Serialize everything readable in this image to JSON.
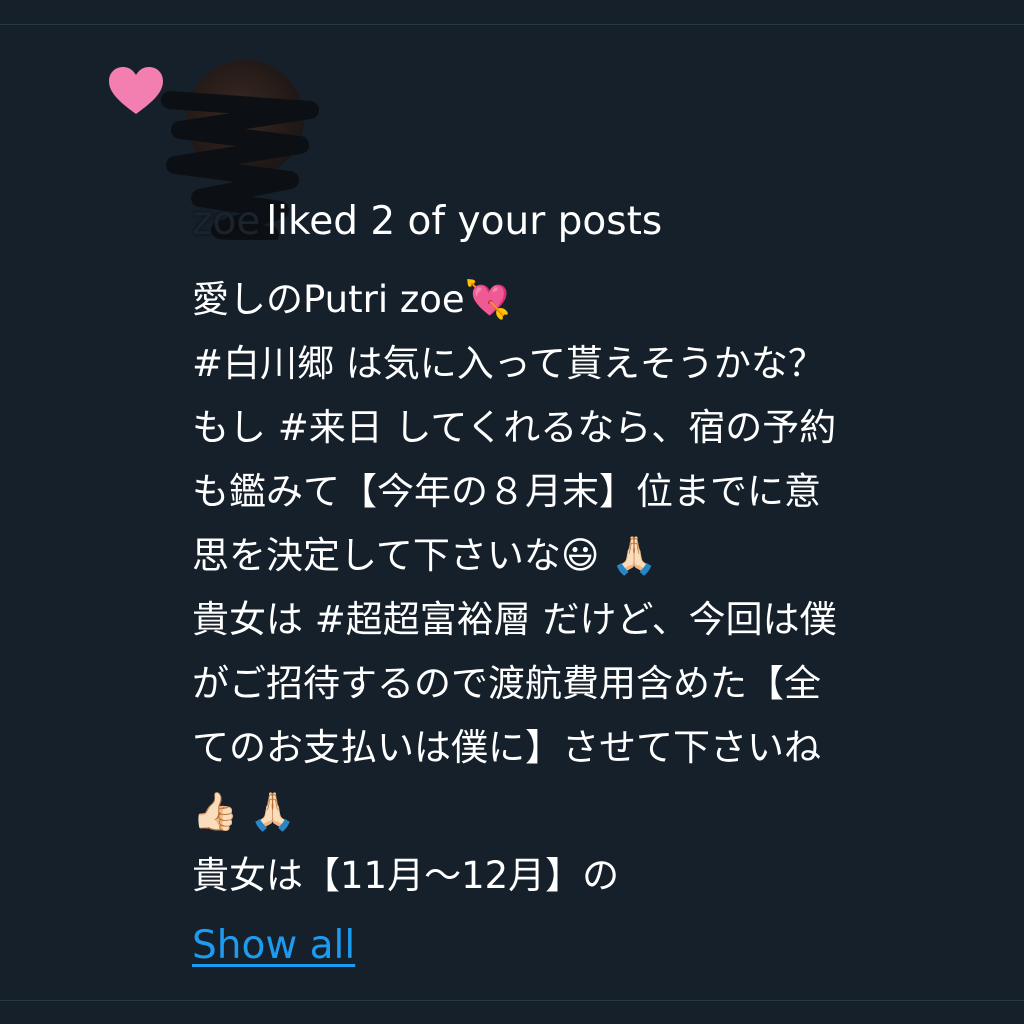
{
  "notification": {
    "actor_name": "zoe",
    "action_text": "liked 2 of your posts",
    "icon": "heart-icon",
    "accent_color": "#f27fb0",
    "avatar": "user-avatar"
  },
  "post": {
    "text": "愛しのPutri zoe💘\n#白川郷 は気に入って貰えそうかな？\nもし #来日 してくれるなら、宿の予約\nも鑑みて【今年の８月末】位までに意\n思を決定して下さいな😃 🙏🏻\n貴女は #超超富裕層 だけど、今回は僕\nがご招待するので渡航費用含めた【全\nてのお支払いは僕に】させて下さいね\n👍🏻 🙏🏻\n貴女は【11月～12月】の"
  },
  "show_all_label": "Show all",
  "colors": {
    "background": "#15202b",
    "link": "#1d9bf0",
    "text": "#ffffff"
  }
}
